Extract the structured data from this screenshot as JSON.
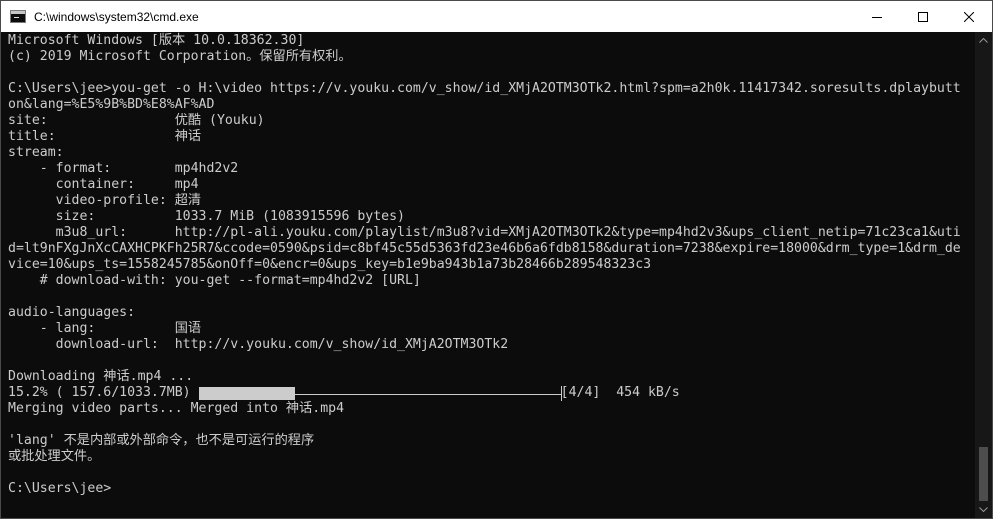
{
  "window": {
    "title": "C:\\windows\\system32\\cmd.exe"
  },
  "icons": {
    "app": "cmd-icon",
    "minimize": "minimize-icon",
    "maximize": "maximize-icon",
    "close": "close-icon"
  },
  "console": {
    "lines": [
      "Microsoft Windows [版本 10.0.18362.30]",
      "(c) 2019 Microsoft Corporation。保留所有权利。",
      "",
      "C:\\Users\\jee>you-get -o H:\\video https://v.youku.com/v_show/id_XMjA2OTM3OTk2.html?spm=a2h0k.11417342.soresults.dplaybutt",
      "on&lang=%E5%9B%BD%E8%AF%AD",
      "site:                优酷 (Youku)",
      "title:               神话",
      "stream:",
      "    - format:        mp4hd2v2",
      "      container:     mp4",
      "      video-profile: 超清",
      "      size:          1033.7 MiB (1083915596 bytes)",
      "      m3u8_url:      http://pl-ali.youku.com/playlist/m3u8?vid=XMjA2OTM3OTk2&type=mp4hd2v3&ups_client_netip=71c23ca1&uti",
      "d=lt9nFXgJnXcCAXHCPKFh25R7&ccode=0590&psid=c8bf45c55d5363fd23e46b6a6fdb8158&duration=7238&expire=18000&drm_type=1&drm_de",
      "vice=10&ups_ts=1558245785&onOff=0&encr=0&ups_key=b1e9ba943b1a73b28466b289548323c3",
      "    # download-with: you-get --format=mp4hd2v2 [URL]",
      "",
      "audio-languages:",
      "    - lang:          国语",
      "      download-url:  http://v.youku.com/v_show/id_XMjA2OTM3OTk2",
      "",
      "Downloading 神话.mp4 ..."
    ],
    "progress": {
      "text": "15.2% ( 157.6/1033.7MB)",
      "fraction": 0.152,
      "part": "[4/4]",
      "speed": "454 kB/s"
    },
    "after_lines": [
      "Merging video parts... Merged into 神话.mp4",
      "",
      "'lang' 不是内部或外部命令，也不是可运行的程序",
      "或批处理文件。",
      "",
      "C:\\Users\\jee>"
    ]
  },
  "scrollbar": {
    "position": 1.0,
    "visible_fraction": 0.12
  }
}
